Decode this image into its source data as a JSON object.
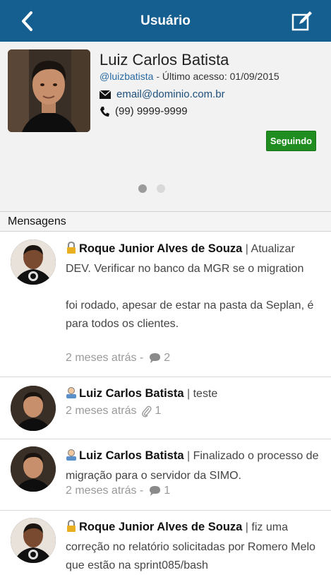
{
  "header": {
    "title": "Usuário"
  },
  "profile": {
    "name": "Luiz Carlos Batista",
    "handle": "@luizbatista",
    "separator": " - ",
    "last_access": "Último acesso: 01/09/2015",
    "email": "email@dominio.com.br",
    "phone": "(99) 9999-9999",
    "follow_label": "Seguindo"
  },
  "section": {
    "title": "Mensagens"
  },
  "messages": [
    {
      "author": "Roque Junior Alves de Souza",
      "badge": "lock-icon",
      "pipe": " | ",
      "text_line1": "Atualizar DEV. Verificar no banco da MGR se o migration",
      "text_line2": "foi rodado, apesar de estar na pasta da Seplan, é para todos os clientes.",
      "time": "2 meses atrás -",
      "count": "2",
      "count_icon": "comment-icon"
    },
    {
      "author": "Luiz Carlos Batista",
      "badge": "user-icon",
      "pipe": " | ",
      "text_line1": "teste",
      "time": "2 meses atrás",
      "count": "1",
      "count_icon": "paperclip-icon"
    },
    {
      "author": "Luiz Carlos Batista",
      "badge": "user-icon",
      "pipe": " | ",
      "text_line1": "Finalizado o processo de migração para o servidor da SIMO.",
      "time": "2 meses atrás -",
      "count": "1",
      "count_icon": "comment-icon"
    },
    {
      "author": "Roque Junior Alves de Souza",
      "badge": "lock-icon",
      "pipe": " | ",
      "text_line1": "fiz uma correção no relatório solicitadas por Romero Melo que estão na sprint085/bash",
      "time": "",
      "count": "",
      "count_icon": ""
    }
  ],
  "colors": {
    "topbar": "#155f90",
    "follow": "#1f8d1f",
    "link": "#2a6aa0"
  }
}
